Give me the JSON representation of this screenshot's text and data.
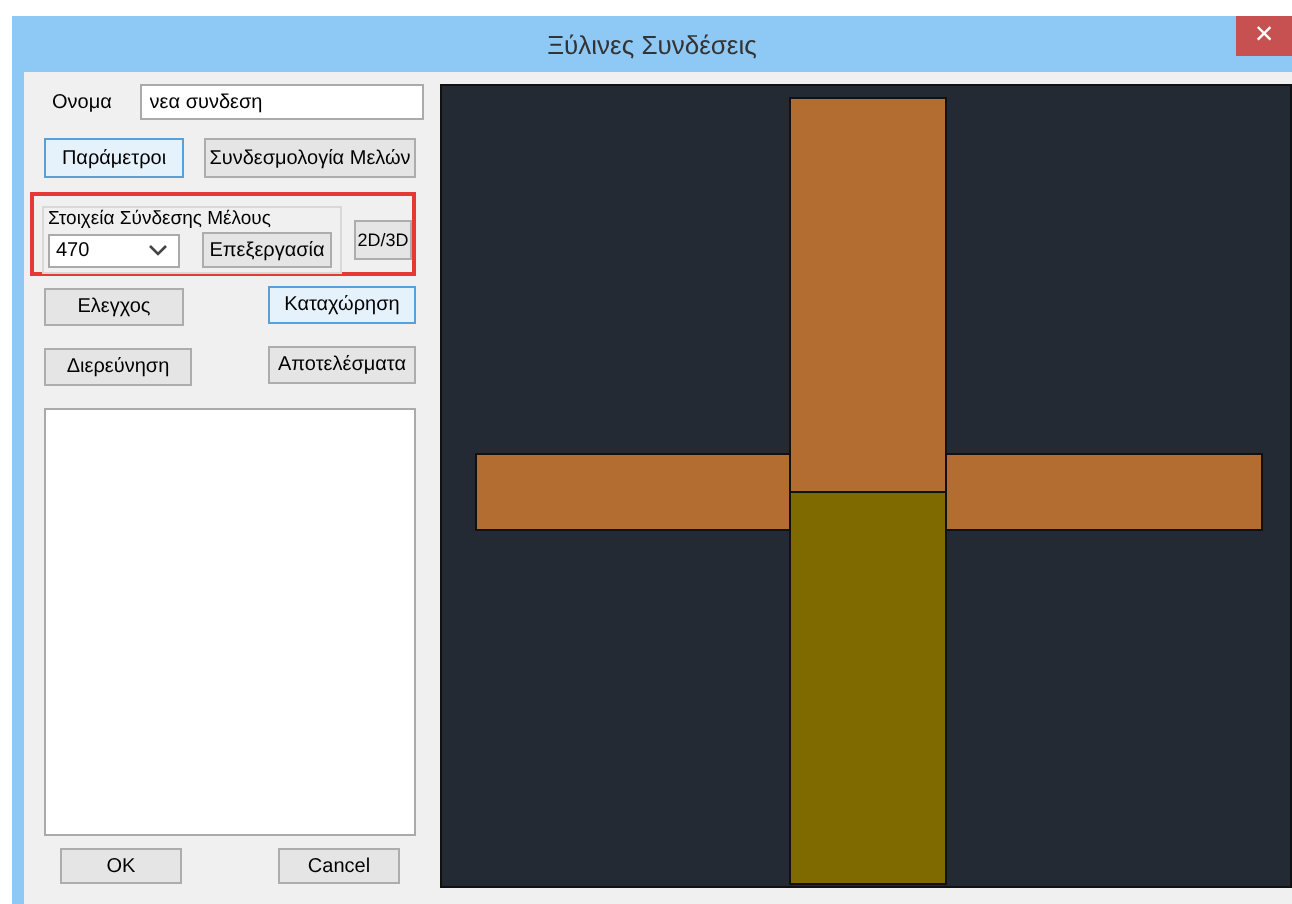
{
  "window": {
    "title": "Ξύλινες Συνδέσεις",
    "close": "×"
  },
  "name_field": {
    "label": "Ονομα",
    "value": "νεα συνδεση"
  },
  "top_buttons": [
    {
      "label": "Παράμετροι",
      "highlighted": true
    },
    {
      "label": "Συνδεσμολογία Μελών",
      "highlighted": false
    }
  ],
  "member_group": {
    "title": "Στοιχεία Σύνδεσης Μέλους",
    "select_value": "470",
    "edit_button": "Επεξεργασία",
    "view_button": "2D/3D"
  },
  "action_buttons": [
    {
      "label": "Ελεγχος",
      "highlighted": false
    },
    {
      "label": "Καταχώρηση",
      "highlighted": true
    },
    {
      "label": "Διερεύνηση",
      "highlighted": false
    },
    {
      "label": "Αποτελέσματα",
      "highlighted": false
    }
  ],
  "dialog_buttons": [
    "OK",
    "Cancel"
  ]
}
